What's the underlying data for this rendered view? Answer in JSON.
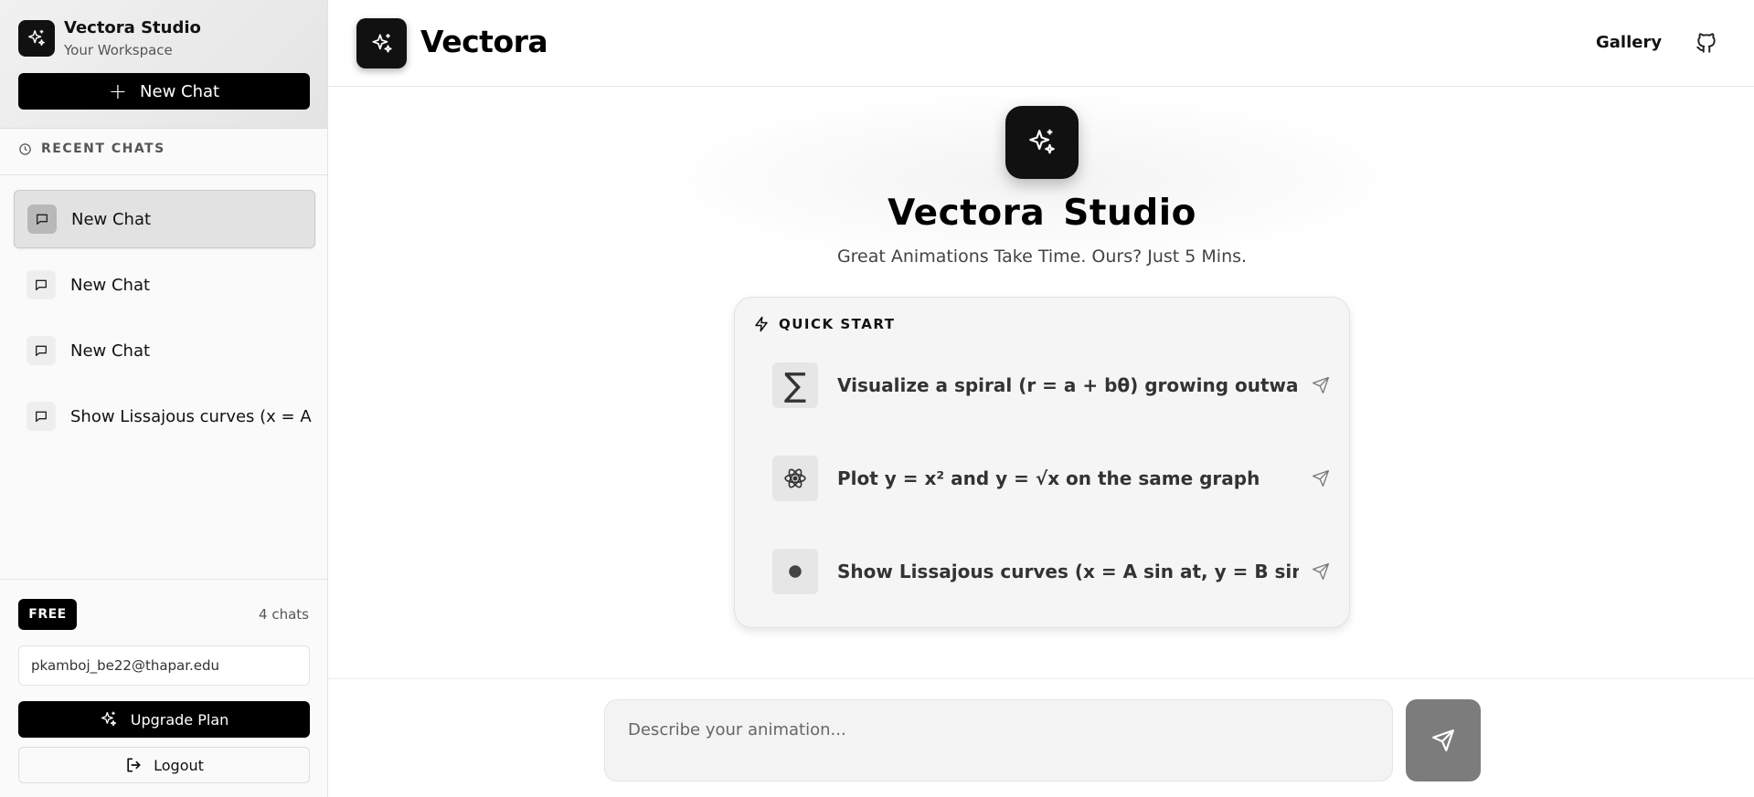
{
  "workspace": {
    "name": "Vectora Studio",
    "subtitle": "Your Workspace",
    "new_chat_label": "New Chat"
  },
  "recent": {
    "heading": "RECENT CHATS",
    "items": [
      {
        "label": "New Chat",
        "active": true
      },
      {
        "label": "New Chat",
        "active": false
      },
      {
        "label": "New Chat",
        "active": false
      },
      {
        "label": "Show Lissajous curves (x = A sin at, y = B sin bt)",
        "active": false
      }
    ]
  },
  "account": {
    "plan_badge": "FREE",
    "chat_count": "4 chats",
    "email": "pkamboj_be22@thapar.edu",
    "upgrade_label": "Upgrade Plan",
    "logout_label": "Logout"
  },
  "header": {
    "brand": "Vectora",
    "gallery_label": "Gallery",
    "github_icon": "github-icon"
  },
  "hero": {
    "title": "Vectora Studio",
    "subtitle": "Great Animations Take Time. Ours? Just 5 Mins."
  },
  "quick_start": {
    "heading": "QUICK START",
    "items": [
      {
        "icon": "sigma-icon",
        "glyph": "∑",
        "label": "Visualize a spiral (r = a + bθ) growing outward"
      },
      {
        "icon": "atom-icon",
        "glyph": "",
        "label": "Plot y = x² and y = √x on the same graph"
      },
      {
        "icon": "dot-icon",
        "glyph": "",
        "label": "Show Lissajous curves (x = A sin at, y = B sin bt)"
      }
    ]
  },
  "composer": {
    "placeholder": "Describe your animation...",
    "value": ""
  },
  "colors": {
    "primary": "#000000",
    "send_button": "#7c7c7c",
    "active_chat": "#e2e2e2"
  }
}
